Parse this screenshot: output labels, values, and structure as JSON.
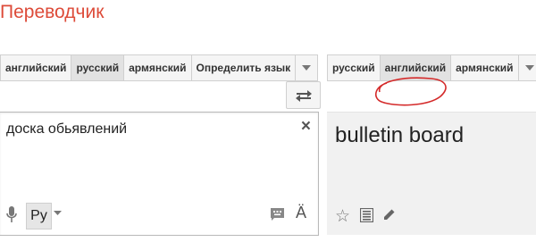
{
  "app": {
    "title": "Переводчик"
  },
  "source_tabs": [
    "английский",
    "русский",
    "армянский",
    "Определить язык"
  ],
  "target_tabs": [
    "русский",
    "английский",
    "армянский"
  ],
  "source": {
    "text": "доска обьявлений",
    "input_method": "Ру"
  },
  "result": {
    "text": "bulletin board"
  },
  "icons": {
    "close": "×",
    "keyboard_letter": "Ä",
    "star": "☆"
  },
  "colors": {
    "brand": "#dd4b39",
    "annotation": "#d42a2a"
  }
}
